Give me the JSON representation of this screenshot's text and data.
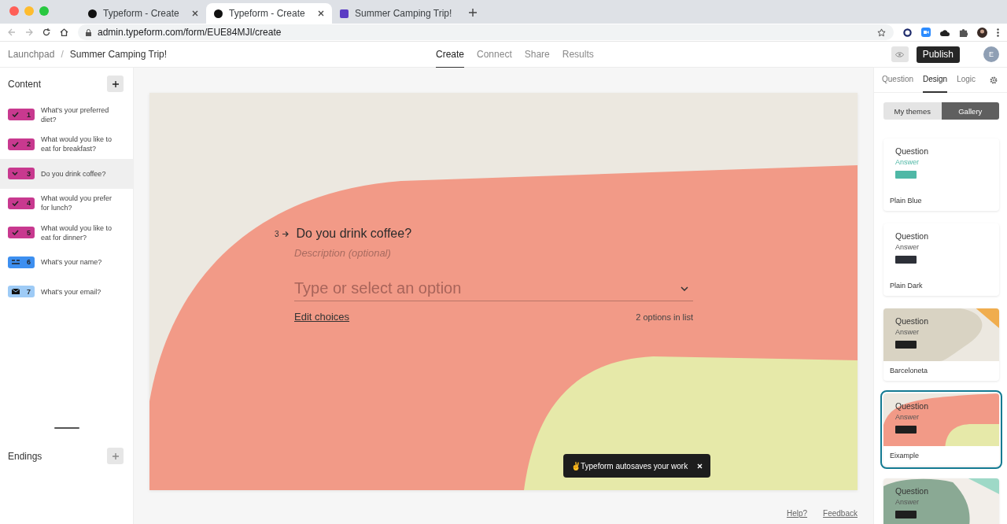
{
  "browser": {
    "tabs": [
      {
        "title": "Typeform - Create",
        "kind": "typeform",
        "selected": false
      },
      {
        "title": "Typeform - Create",
        "kind": "typeform",
        "selected": true
      },
      {
        "title": "Summer Camping Trip!",
        "kind": "form",
        "selected": false
      }
    ],
    "address": "admin.typeform.com/form/EUE84MJI/create"
  },
  "header": {
    "breadcrumb": [
      "Launchpad",
      "Summer Camping Trip!"
    ],
    "separator": "/",
    "nav": [
      {
        "label": "Create",
        "selected": true
      },
      {
        "label": "Connect",
        "selected": false
      },
      {
        "label": "Share",
        "selected": false
      },
      {
        "label": "Results",
        "selected": false
      }
    ],
    "publish": "Publish",
    "avatar": "E"
  },
  "sidebar": {
    "title": "Content",
    "questions": [
      {
        "number": "1",
        "kind": "multiple-choice",
        "color": "#c8398f",
        "label": "What's your preferred diet?",
        "selected": false
      },
      {
        "number": "2",
        "kind": "multiple-choice",
        "color": "#c8398f",
        "label": "What would you like to eat for breakfast?",
        "selected": false
      },
      {
        "number": "3",
        "kind": "dropdown",
        "color": "#c8398f",
        "label": "Do you drink coffee?",
        "selected": true
      },
      {
        "number": "4",
        "kind": "multiple-choice",
        "color": "#c8398f",
        "label": "What would you prefer for lunch?",
        "selected": false
      },
      {
        "number": "5",
        "kind": "multiple-choice",
        "color": "#c8398f",
        "label": "What would you like to eat for dinner?",
        "selected": false
      },
      {
        "number": "6",
        "kind": "short-text",
        "color": "#3d8ff0",
        "label": "What's your name?",
        "selected": false
      },
      {
        "number": "7",
        "kind": "email",
        "color": "#9ecbf6",
        "label": "What's your email?",
        "selected": false
      }
    ],
    "endings_title": "Endings"
  },
  "canvas": {
    "number": "3",
    "question": "Do you drink coffee?",
    "description_placeholder": "Description (optional)",
    "dropdown_placeholder": "Type or select an option",
    "edit_link": "Edit choices",
    "options_count": "2 options in list"
  },
  "toast": {
    "text": "✌️Typeform autosaves your work"
  },
  "footer": {
    "links": [
      "Help?",
      "Feedback"
    ]
  },
  "design_panel": {
    "tabs": [
      {
        "label": "Question",
        "selected": false
      },
      {
        "label": "Design",
        "selected": true
      },
      {
        "label": "Logic",
        "selected": false
      }
    ],
    "segments": [
      {
        "label": "My themes",
        "selected": false
      },
      {
        "label": "Gallery",
        "selected": true
      }
    ],
    "themes": [
      {
        "name": "Plain Blue",
        "kind": "plain",
        "color": "#4fb8a6",
        "question": "Question",
        "answer": "Answer",
        "selected": false
      },
      {
        "name": "Plain Dark",
        "kind": "plain",
        "color": "#2d3038",
        "question": "Question",
        "answer": "Answer",
        "selected": false
      },
      {
        "name": "Barceloneta",
        "kind": "sand",
        "color": "#1f1f1f",
        "question": "Question",
        "answer": "Answer",
        "selected": false
      },
      {
        "name": "Eixample",
        "kind": "coral",
        "color": "#1f1f1f",
        "question": "Question",
        "answer": "Answer",
        "selected": true
      },
      {
        "kind": "sage",
        "color": "#1f1f1f",
        "question": "Question",
        "answer": "Answer",
        "selected": false
      }
    ]
  }
}
